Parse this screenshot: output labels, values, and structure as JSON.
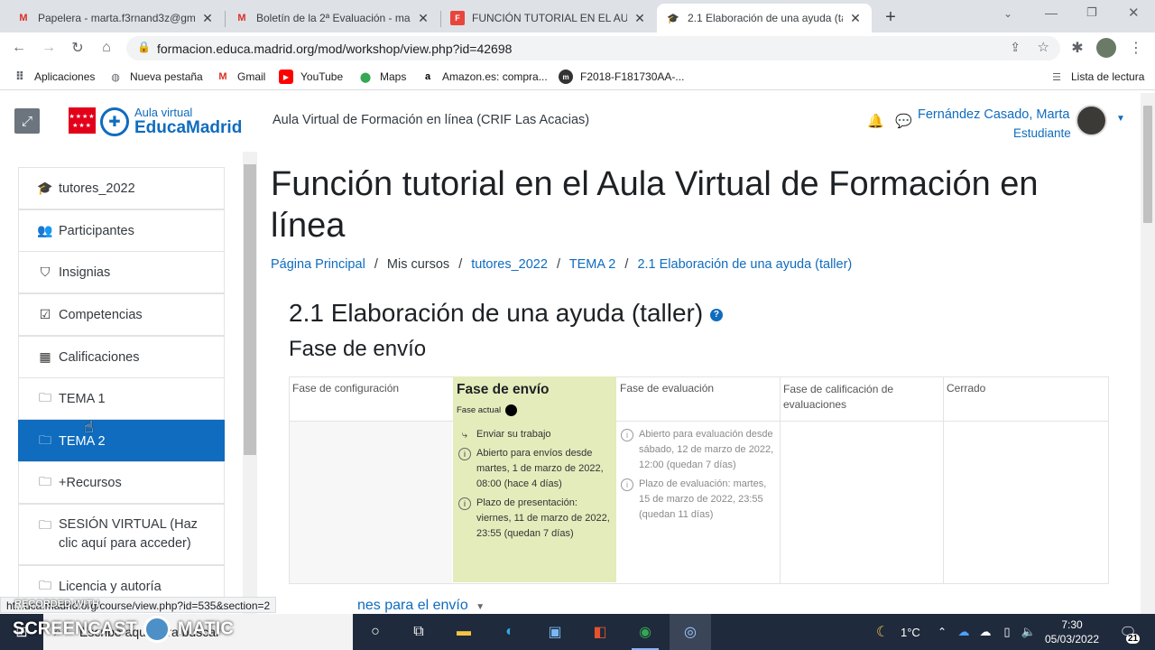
{
  "tabs": [
    {
      "title": "Papelera - marta.f3rnand3z@gm",
      "icon": "gmail-icon"
    },
    {
      "title": "Boletín de la 2ª Evaluación - mar",
      "icon": "gmail-icon"
    },
    {
      "title": "FUNCIÓN TUTORIAL EN EL AULA",
      "icon": "slides-icon"
    },
    {
      "title": "2.1 Elaboración de una ayuda (ta",
      "icon": "moodle-cap-icon"
    }
  ],
  "url": "formacion.educa.madrid.org/mod/workshop/view.php?id=42698",
  "bookmarks": {
    "apps": "Aplicaciones",
    "items": [
      "Nueva pestaña",
      "Gmail",
      "YouTube",
      "Maps",
      "Amazon.es: compra...",
      "F2018-F181730AA-..."
    ],
    "reading_list": "Lista de lectura"
  },
  "header": {
    "logo_top": "Aula virtual",
    "logo_bottom": "EducaMadrid",
    "site_name": "Aula Virtual de Formación en línea (CRIF Las Acacias)",
    "user_name": "Fernández Casado, Marta",
    "user_role": "Estudiante"
  },
  "sidebar": {
    "items": [
      {
        "label": "tutores_2022",
        "icon": "graduation-cap-icon"
      },
      {
        "label": "Participantes",
        "icon": "users-icon"
      },
      {
        "label": "Insignias",
        "icon": "shield-icon"
      },
      {
        "label": "Competencias",
        "icon": "check-square-icon"
      },
      {
        "label": "Calificaciones",
        "icon": "table-icon"
      },
      {
        "label": "TEMA 1",
        "icon": "folder-icon"
      },
      {
        "label": "TEMA 2",
        "icon": "folder-icon"
      },
      {
        "label": "+Recursos",
        "icon": "folder-icon"
      },
      {
        "label": "SESIÓN VIRTUAL (Haz clic aquí para acceder)",
        "icon": "folder-icon"
      },
      {
        "label": "Licencia y autoría",
        "icon": "folder-icon"
      }
    ]
  },
  "main": {
    "page_title": "Función tutorial en el Aula Virtual de Formación en línea",
    "breadcrumb": [
      "Página Principal",
      "Mis cursos",
      "tutores_2022",
      "TEMA 2",
      "2.1 Elaboración de una ayuda (taller)"
    ],
    "activity_title": "2.1 Elaboración de una ayuda (taller)",
    "phase_heading": "Fase de envío",
    "phases": [
      {
        "title": "Fase de configuración"
      },
      {
        "title": "Fase de envío",
        "current_label": "Fase actual"
      },
      {
        "title": "Fase de evaluación"
      },
      {
        "title": "Fase de calificación de evaluaciones"
      },
      {
        "title": "Cerrado"
      }
    ],
    "submission_tasks": [
      "Enviar su trabajo",
      "Abierto para envíos desde martes, 1 de marzo de 2022, 08:00 (hace 4 días)",
      "Plazo de presentación: viernes, 11 de marzo de 2022, 23:55 (quedan 7 días)"
    ],
    "assessment_tasks": [
      "Abierto para evaluación desde sábado, 12 de marzo de 2022, 12:00 (quedan 7 días)",
      "Plazo de evaluación: martes, 15 de marzo de 2022, 23:55 (quedan 11 días)"
    ],
    "instructions_link": "nes para el envío"
  },
  "status_url": "ht...uca.madrid.org/course/view.php?id=535&section=2",
  "watermark": {
    "recorded": "RECORDED WITH",
    "brand": "SCREENCAST",
    "brand2": "MATIC"
  },
  "taskbar": {
    "search_placeholder": "Escribe aquí para buscar",
    "weather": "1°C",
    "time": "7:30",
    "date": "05/03/2022",
    "notifications": "21"
  },
  "colors": {
    "accent": "#0f6cbf",
    "current_phase_bg": "#e4ecbc",
    "brand_red": "#e2001a"
  }
}
